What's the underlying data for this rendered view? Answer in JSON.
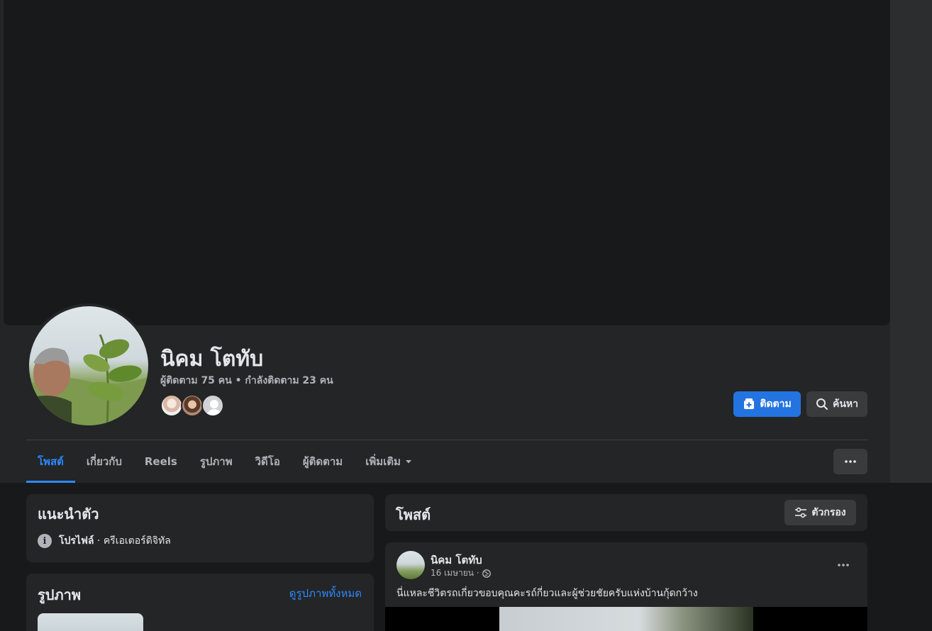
{
  "profile": {
    "name": "นิคม โตทับ",
    "stats": "ผู้ติดตาม 75 คน • กำลังติดตาม 23 คน"
  },
  "actions": {
    "follow_label": "ติดตาม",
    "search_label": "ค้นหา"
  },
  "tabs": [
    {
      "label": "โพสต์",
      "active": true
    },
    {
      "label": "เกี่ยวกับ"
    },
    {
      "label": "Reels"
    },
    {
      "label": "รูปภาพ"
    },
    {
      "label": "วิดีโอ"
    },
    {
      "label": "ผู้ติดตาม"
    },
    {
      "label": "เพิ่มเติม"
    }
  ],
  "intro": {
    "title": "แนะนำตัว",
    "profile_type": "โปรไฟล์",
    "profile_category": " · ครีเอเตอร์ดิจิทัล"
  },
  "photos": {
    "title": "รูปภาพ",
    "see_all": "ดูรูปภาพทั้งหมด"
  },
  "posts": {
    "title": "โพสต์",
    "filter_label": "ตัวกรอง"
  },
  "post": {
    "author": "นิคม โตทับ",
    "date": "16 เมษายน ·",
    "text": "นี่แหละชีวิตรถเกี่ยวขอบคุณคะรถ์กี่ยวและผู้ช่วยชัยครับแห่งบ้านกุ้ดกว้าง"
  },
  "colors": {
    "accent": "#2d88ff",
    "button_primary": "#2374e1",
    "surface": "#242526",
    "background": "#18191a"
  }
}
